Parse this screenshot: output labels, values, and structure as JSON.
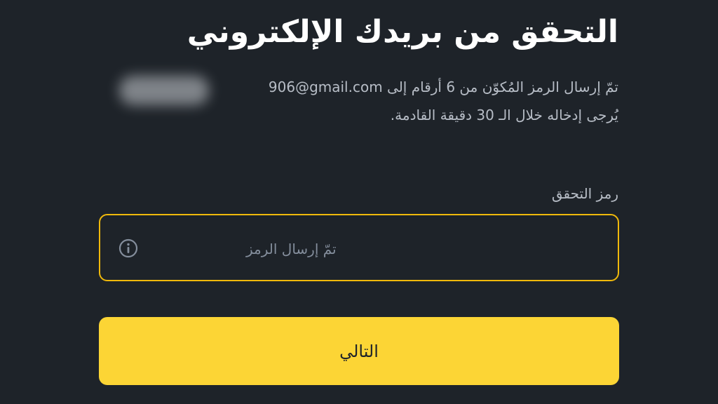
{
  "header": {
    "title": "التحقق من بريدك الإلكتروني"
  },
  "description": {
    "line1_prefix": "تمّ إرسال الرمز المُكوّن من 6 أرقام إلى",
    "email": "906@gmail.com",
    "line2": "يُرجى إدخاله خلال الـ 30 دقيقة القادمة."
  },
  "code_field": {
    "label": "رمز التحقق",
    "placeholder": "تمّ إرسال الرمز",
    "value": "",
    "icon": "info-icon"
  },
  "next_button": {
    "label": "التالي"
  },
  "colors": {
    "background": "#1e2329",
    "accent": "#fcd535",
    "input_border": "#f0b90b",
    "text_primary": "#ffffff",
    "text_secondary": "#b7bdc6",
    "placeholder": "#848e9c"
  }
}
